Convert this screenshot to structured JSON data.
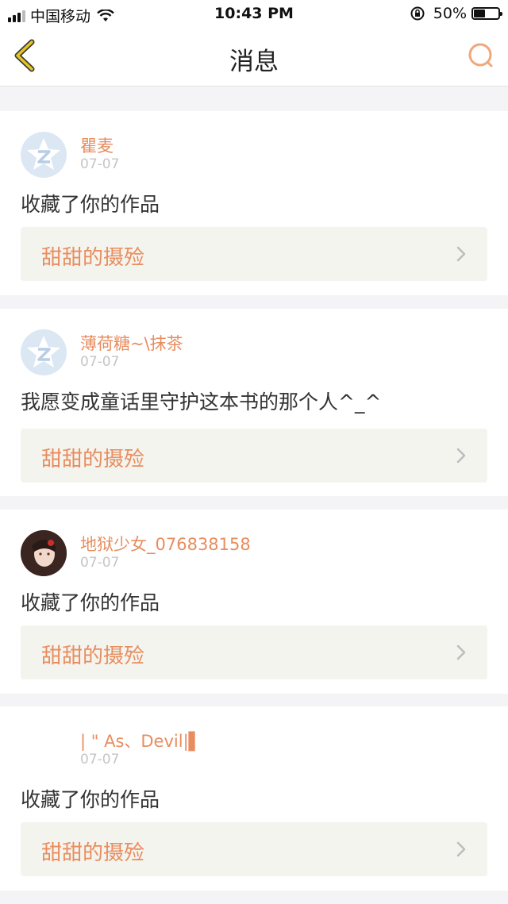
{
  "status_bar": {
    "carrier": "中国移动",
    "time": "10:43 PM",
    "battery": "50%"
  },
  "nav": {
    "title": "消息"
  },
  "notifications": [
    {
      "username": "瞿麦",
      "date": "07-07",
      "message": "收藏了你的作品",
      "work_title": "甜甜的摄殓",
      "avatar": "default-avatar"
    },
    {
      "username": "薄荷糖~\\抹茶",
      "date": "07-07",
      "message": "我愿变成童话里守护这本书的那个人^_^",
      "work_title": "甜甜的摄殓",
      "avatar": "default-avatar"
    },
    {
      "username": "地狱少女_076838158",
      "date": "07-07",
      "message": "收藏了你的作品",
      "work_title": "甜甜的摄殓",
      "avatar": "photo-avatar"
    },
    {
      "username": "| \" As、Devil|▌",
      "date": "07-07",
      "message": "收藏了你的作品",
      "work_title": "甜甜的摄殓",
      "avatar": "blank-avatar"
    }
  ],
  "colors": {
    "accent": "#e88d5f",
    "back_icon": "#e8c51b",
    "work_bg": "#f4f4ee"
  }
}
